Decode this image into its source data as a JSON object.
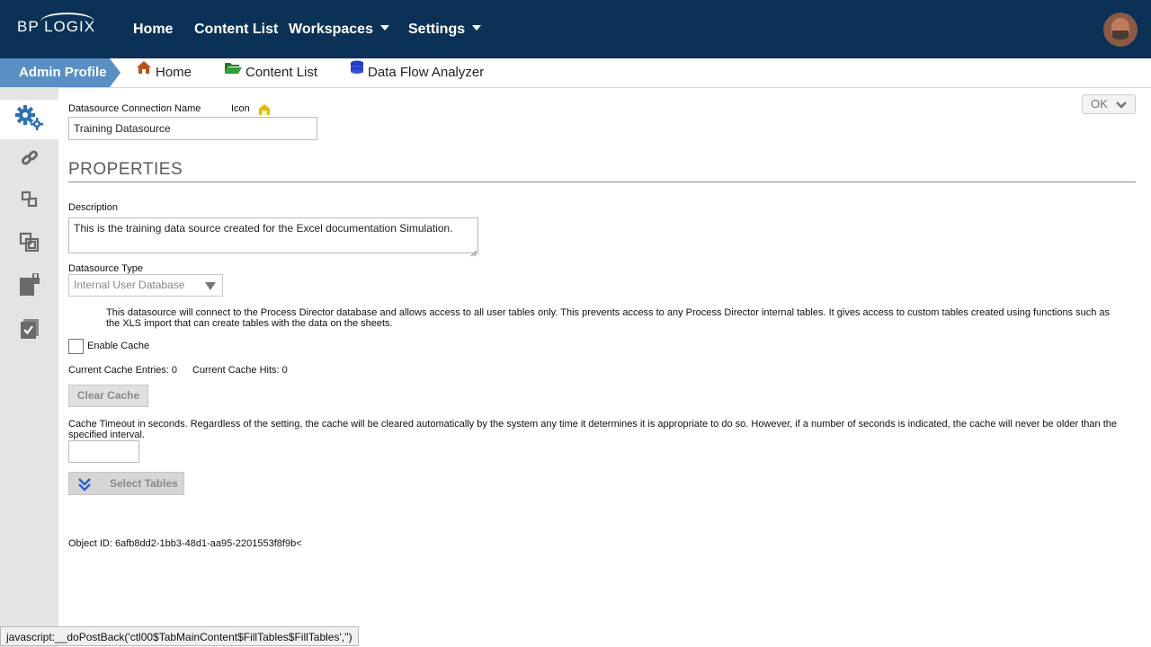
{
  "header": {
    "logo_text": "BP LOGIX",
    "nav": [
      "Home",
      "Content List",
      "Workspaces",
      "Settings"
    ]
  },
  "breadcrumb": {
    "profile": "Admin Profile",
    "items": [
      "Home",
      "Content List",
      "Data Flow Analyzer"
    ]
  },
  "sidebar": {
    "icons": [
      "gears-icon",
      "link-icon",
      "tables-icon",
      "copy-icon",
      "locked-document-icon",
      "checklist-icon"
    ]
  },
  "form": {
    "ok_label": "OK",
    "name_label": "Datasource Connection Name",
    "icon_label": "Icon",
    "name_value": "Training Datasource",
    "section_title": "PROPERTIES",
    "description_label": "Description",
    "description_value": "This is the training data source created for the Excel documentation Simulation.",
    "type_label": "Datasource Type",
    "type_value": "Internal User Database",
    "type_help": "This datasource will connect to the Process Director database and allows access to all user tables only. This prevents access to any Process Director internal tables. It gives access to custom tables created using functions such as the XLS import that can create tables with the data on the sheets.",
    "enable_cache_label": "Enable Cache",
    "cache_entries": "Current Cache Entries: 0",
    "cache_hits": "Current Cache Hits: 0",
    "clear_cache_label": "Clear Cache",
    "timeout_help": "Cache Timeout in seconds. Regardless of the setting, the cache will be cleared automatically by the system any time it determines it is appropriate to do so. However, if a number of seconds is indicated, the cache will never be older than the specified interval.",
    "timeout_value": "",
    "select_tables_label": "Select Tables",
    "object_id": "Object ID: 6afb8dd2-1bb3-48d1-aa95-2201553f8f9b<"
  },
  "status_bar": "javascript:__doPostBack('ctl00$TabMainContent$FillTables$FillTables','')",
  "colors": {
    "topbar": "#0b3256",
    "admin_tab": "#5a8fc4",
    "sidebar": "#e4e4e4",
    "accent_icon": "#2d6fb0"
  }
}
